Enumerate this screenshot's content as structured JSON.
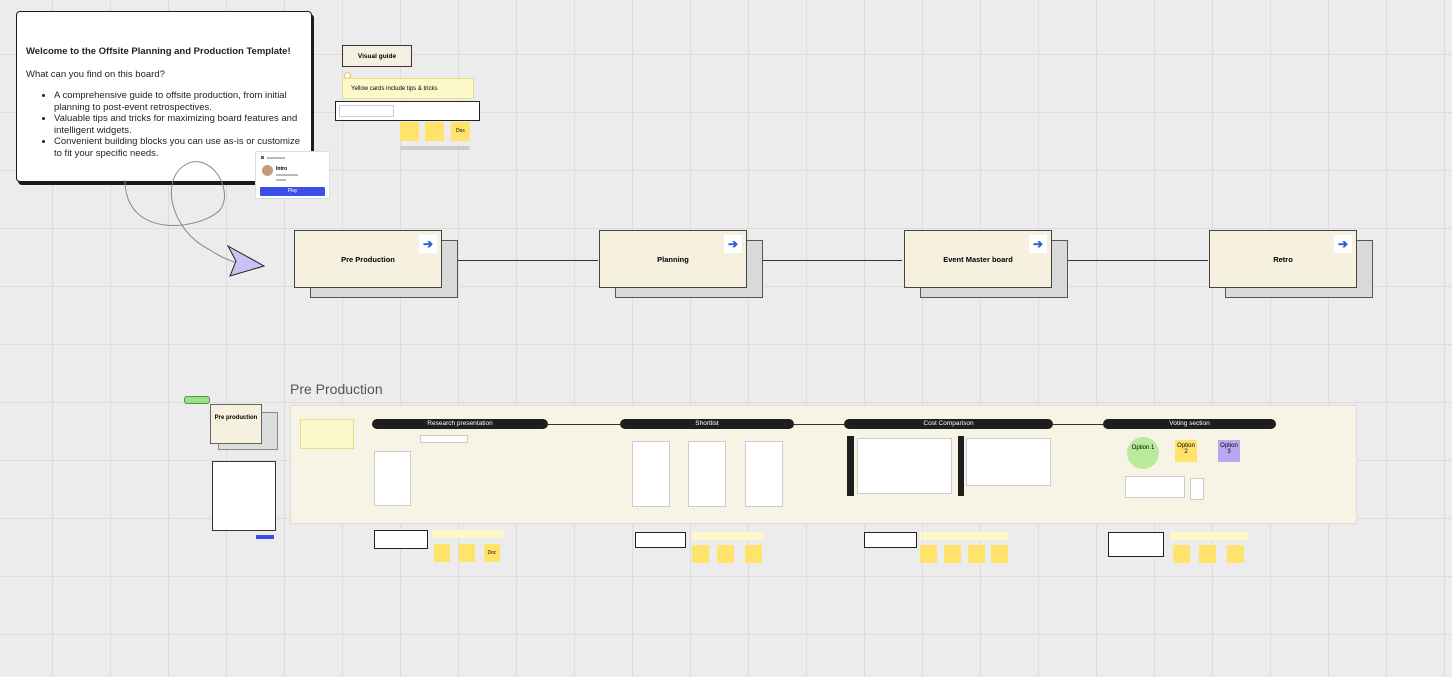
{
  "welcome": {
    "title": "Welcome to the Offsite Planning and Production Template!",
    "question": "What can you find on this board?",
    "bullets": [
      "A comprehensive guide to offsite production, from initial planning to post-event retrospectives.",
      "Valuable tips and tricks for maximizing board features and intelligent widgets.",
      "Convenient building blocks you can use as-is or customize to fit your specific needs."
    ]
  },
  "intro_widget": {
    "label": "Intro",
    "play_label": "Play"
  },
  "visual_guide": {
    "label": "Visual guide",
    "tip": "Yellow cards include tips & tricks",
    "doc_label": "Doc"
  },
  "stages": [
    {
      "label": "Pre Production"
    },
    {
      "label": "Planning"
    },
    {
      "label": "Event Master board"
    },
    {
      "label": "Retro"
    }
  ],
  "stage_arrow_icon": "arrow-right-icon",
  "section": {
    "title": "Pre Production",
    "side_card": "Pre production",
    "pills": [
      "Research presentation",
      "Shortlist",
      "Cost Comparison",
      "Voting section"
    ],
    "options": [
      "Option 1",
      "Option 2",
      "Option 3"
    ],
    "doc_label": "Doc"
  },
  "colors": {
    "accent_blue": "#2a5bd7",
    "sticky_yellow": "#ffe36b",
    "purple_pointer": "#c9c3f5",
    "section_bg": "#f7f4e6"
  }
}
